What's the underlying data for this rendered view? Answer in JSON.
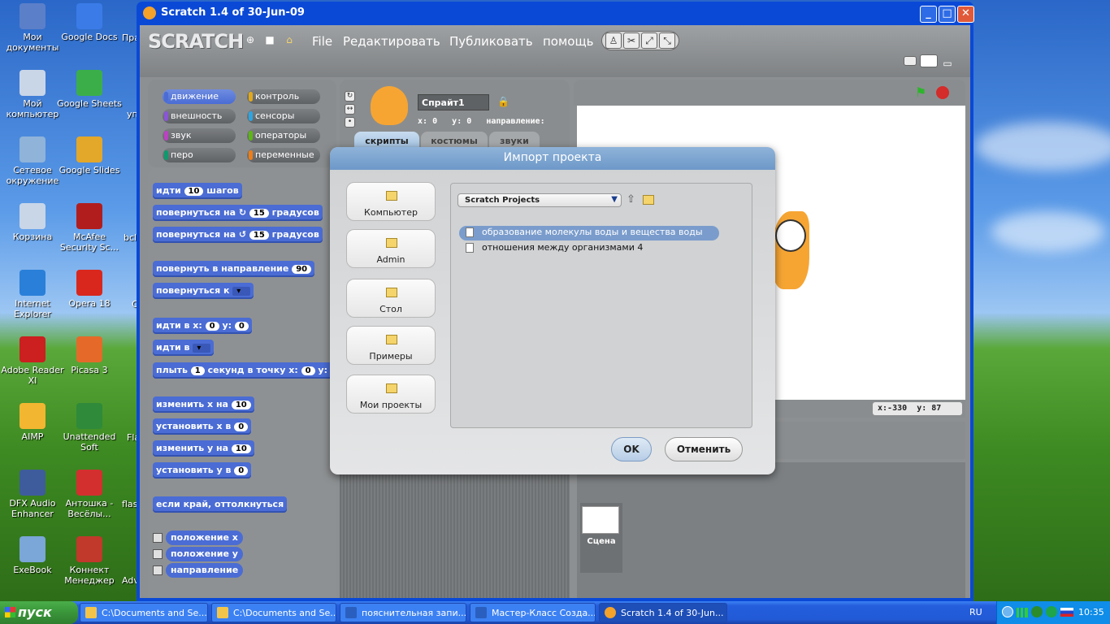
{
  "desktop": {
    "icons": [
      {
        "label": "Мои документы",
        "icon": "folder-documents-icon"
      },
      {
        "label": "Google Docs",
        "icon": "shortcut-icon"
      },
      {
        "label": "Мой компьютер",
        "icon": "computer-icon"
      },
      {
        "label": "Google Sheets",
        "icon": "shortcut-icon"
      },
      {
        "label": "Сетевое окружение",
        "icon": "network-icon"
      },
      {
        "label": "Google Slides",
        "icon": "shortcut-icon"
      },
      {
        "label": "Корзина",
        "icon": "recycle-bin-icon"
      },
      {
        "label": "McAfee Security Sc...",
        "icon": "mcafee-icon"
      },
      {
        "label": "Internet Explorer",
        "icon": "ie-icon"
      },
      {
        "label": "Opera 18",
        "icon": "opera-icon"
      },
      {
        "label": "Adobe Reader XI",
        "icon": "adobe-icon"
      },
      {
        "label": "Picasa 3",
        "icon": "picasa-icon"
      },
      {
        "label": "AIMP",
        "icon": "aimp-icon"
      },
      {
        "label": "Unattended Soft",
        "icon": "star-icon"
      },
      {
        "label": "DFX Audio Enhancer",
        "icon": "dfx-icon"
      },
      {
        "label": "Антошка - Весёлы...",
        "icon": "antoshka-icon"
      },
      {
        "label": "ExeBook",
        "icon": "book-icon"
      },
      {
        "label": "Коннект Менеджер",
        "icon": "connect-icon"
      }
    ],
    "cut_labels": [
      "Пра хи",
      "уп",
      "bcl",
      "C",
      "Fla",
      "flas",
      "Adv"
    ]
  },
  "window": {
    "title": "Scratch 1.4 of 30-Jun-09"
  },
  "menu": {
    "logo": "SCRATCH",
    "items": [
      "File",
      "Редактировать",
      "Публиковать",
      "помощь"
    ]
  },
  "categories": [
    {
      "label": "движение",
      "color": "#4a6cd4"
    },
    {
      "label": "контроль",
      "color": "#e1a91a"
    },
    {
      "label": "внешность",
      "color": "#8a55d7"
    },
    {
      "label": "сенсоры",
      "color": "#2ca5e2"
    },
    {
      "label": "звук",
      "color": "#bb42c3"
    },
    {
      "label": "операторы",
      "color": "#5cb712"
    },
    {
      "label": "перо",
      "color": "#0e9a6c"
    },
    {
      "label": "переменные",
      "color": "#ee7d16"
    }
  ],
  "blocks": {
    "move": {
      "pre": "идти",
      "n": "10",
      "post": "шагов"
    },
    "turn_right": {
      "pre": "повернуться на",
      "n": "15",
      "post": "градусов"
    },
    "turn_left": {
      "pre": "повернуться на",
      "n": "15",
      "post": "градусов"
    },
    "point_dir": {
      "pre": "повернуть в направление",
      "n": "90"
    },
    "point_to": {
      "pre": "повернуться к"
    },
    "goto_xy": {
      "pre": "идти в x:",
      "x": "0",
      "mid": "y:",
      "y": "0"
    },
    "goto": {
      "pre": "идти в"
    },
    "glide": {
      "pre": "плыть",
      "n": "1",
      "mid": "секунд в точку x:",
      "x": "0",
      "mid2": "y:",
      "y": "0"
    },
    "change_x": {
      "pre": "изменить х на",
      "n": "10"
    },
    "set_x": {
      "pre": "установить х в",
      "n": "0"
    },
    "change_y": {
      "pre": "изменить у на",
      "n": "10"
    },
    "set_y": {
      "pre": "установить у в",
      "n": "0"
    },
    "bounce": {
      "pre": "если край, оттолкнуться"
    },
    "reporters": [
      "положение x",
      "положение y",
      "направление"
    ]
  },
  "sprite": {
    "name": "Спрайт1",
    "x_label": "x:",
    "x": "0",
    "y_label": "y:",
    "y": "0",
    "dir_label": "направление:"
  },
  "tabs": [
    "скрипты",
    "костюмы",
    "звуки"
  ],
  "stage": {
    "coords": {
      "x_label": "x:",
      "x": "-330",
      "y_label": "y:",
      "y": "87"
    },
    "scene_label": "Сцена"
  },
  "dialog": {
    "title": "Импорт проекта",
    "places": [
      {
        "label": "Компьютер",
        "icon": "computer-icon"
      },
      {
        "label": "Admin",
        "icon": "home-icon"
      },
      {
        "label": "Стол",
        "icon": "folder-icon"
      },
      {
        "label": "Примеры",
        "icon": "examples-icon"
      },
      {
        "label": "Мои проекты",
        "icon": "folder-icon"
      }
    ],
    "folder": "Scratch Projects",
    "files": [
      "образование молекулы воды и вещества воды",
      "отношения между организмами 4"
    ],
    "ok": "OK",
    "cancel": "Отменить"
  },
  "taskbar": {
    "start": "пуск",
    "tasks": [
      "C:\\Documents and Se...",
      "C:\\Documents and Se...",
      "пояснительная запи...",
      "Мастер-Класс Созда...",
      "Scratch 1.4 of 30-Jun..."
    ],
    "lang": "RU",
    "clock": "10:35"
  }
}
